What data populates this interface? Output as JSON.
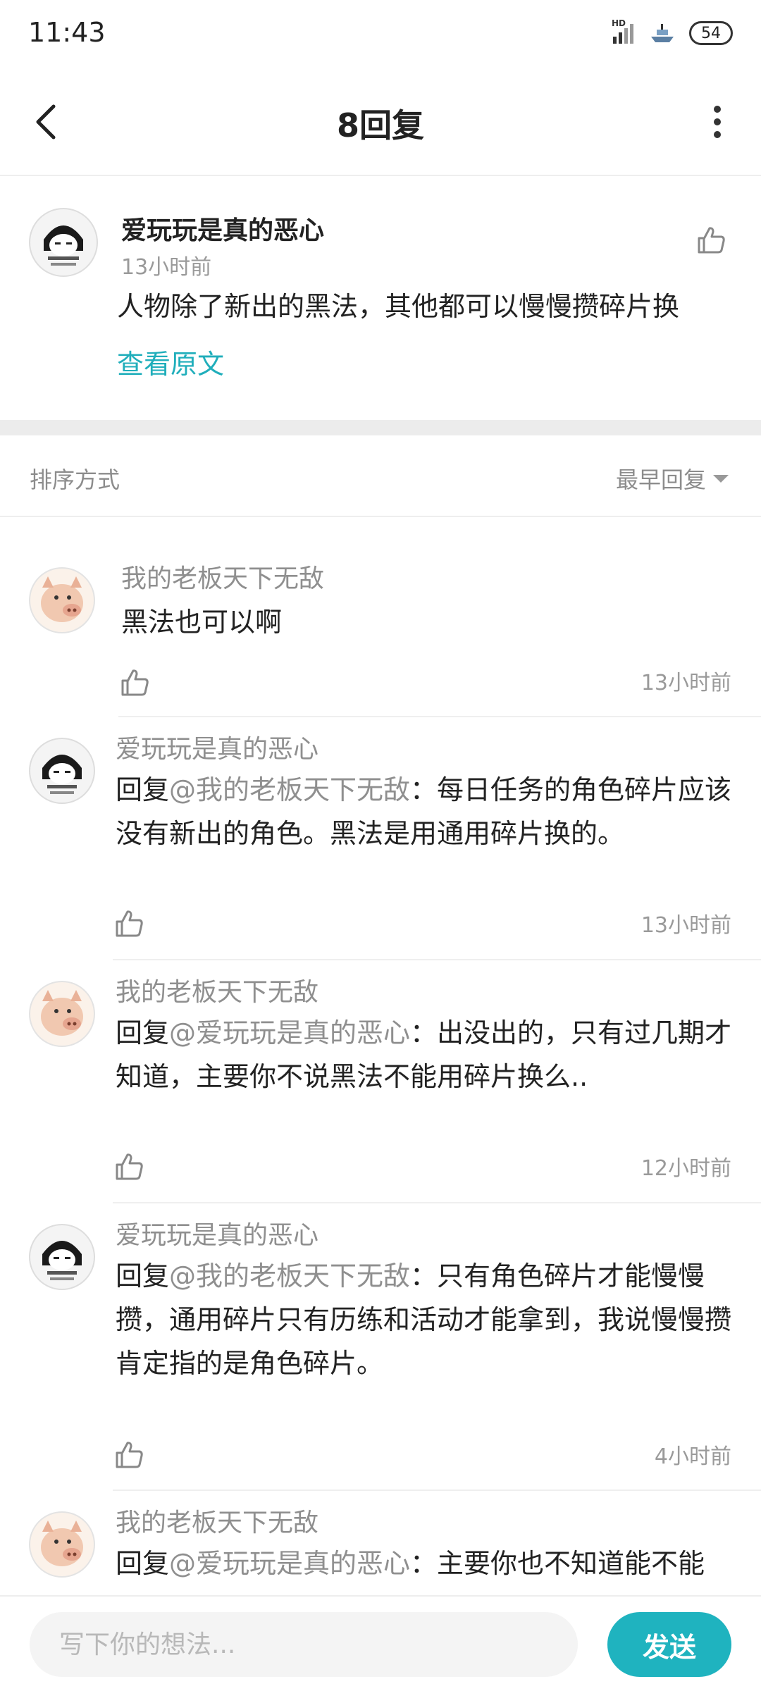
{
  "status_bar": {
    "time": "11:43",
    "battery": "54",
    "network": "HD"
  },
  "header": {
    "title": "8回复"
  },
  "original_post": {
    "username": "爱玩玩是真的恶心",
    "time": "13小时前",
    "content": "人物除了新出的黑法，其他都可以慢慢攒碎片换",
    "view_original": "查看原文"
  },
  "sort": {
    "label": "排序方式",
    "selected": "最早回复"
  },
  "replies": [
    {
      "username": "我的老板天下无敌",
      "prefix": "",
      "mention": "",
      "content": "黑法也可以啊",
      "time": "13小时前"
    },
    {
      "username": "爱玩玩是真的恶心",
      "prefix": "回复",
      "mention": "@我的老板天下无敌",
      "content": "：每日任务的角色碎片应该没有新出的角色。黑法是用通用碎片换的。",
      "time": "13小时前"
    },
    {
      "username": "我的老板天下无敌",
      "prefix": "回复",
      "mention": "@爱玩玩是真的恶心",
      "content": "：出没出的，只有过几期才知道，主要你不说黑法不能用碎片换么..",
      "time": "12小时前"
    },
    {
      "username": "爱玩玩是真的恶心",
      "prefix": "回复",
      "mention": "@我的老板天下无敌",
      "content": "：只有角色碎片才能慢慢攒，通用碎片只有历练和活动才能拿到，我说慢慢攒肯定指的是角色碎片。",
      "time": "4小时前"
    },
    {
      "username": "我的老板天下无敌",
      "prefix": "回复",
      "mention": "@爱玩玩是真的恶心",
      "content": "：主要你也不知道能不能",
      "time": ""
    }
  ],
  "input": {
    "placeholder": "写下你的想法...",
    "send_label": "发送"
  },
  "colors": {
    "accent": "#1fb3bf",
    "link": "#20aebb",
    "muted": "#8f8f8f"
  }
}
